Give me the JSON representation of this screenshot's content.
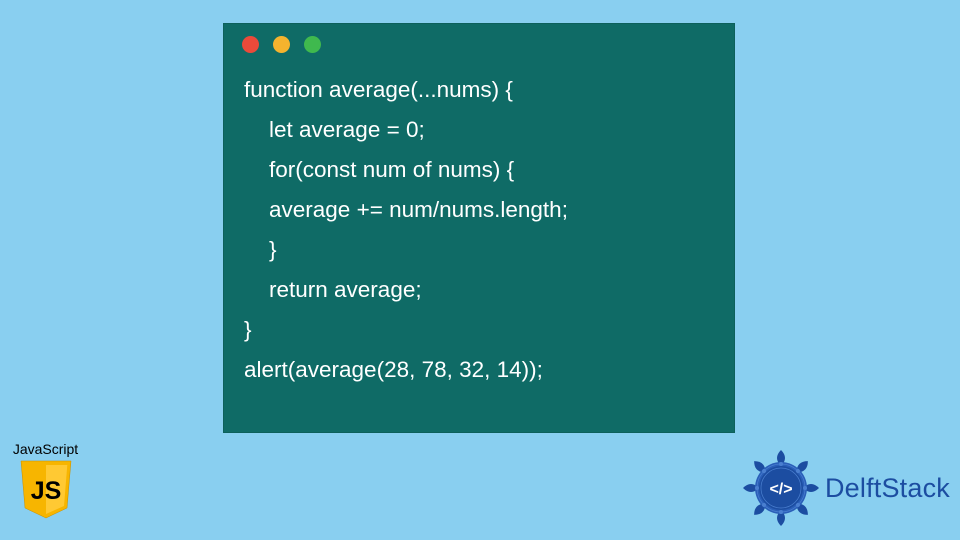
{
  "code": {
    "lines": [
      "function average(...nums) {",
      "    let average = 0;",
      "    for(const num of nums) {",
      "    average += num/nums.length;",
      "    }",
      "    return average;",
      "}",
      "alert(average(28, 78, 32, 14));"
    ]
  },
  "js_badge": {
    "label": "JavaScript",
    "letters": "JS"
  },
  "delft": {
    "brand": "DelftStack",
    "tag": "</>"
  },
  "colors": {
    "bg": "#89cff0",
    "window": "#0f6b66",
    "red": "#eb4a3a",
    "yellow": "#f4b32e",
    "green": "#3fb94e",
    "js_yellow": "#f7b500",
    "delft_blue": "#1c4da1"
  }
}
